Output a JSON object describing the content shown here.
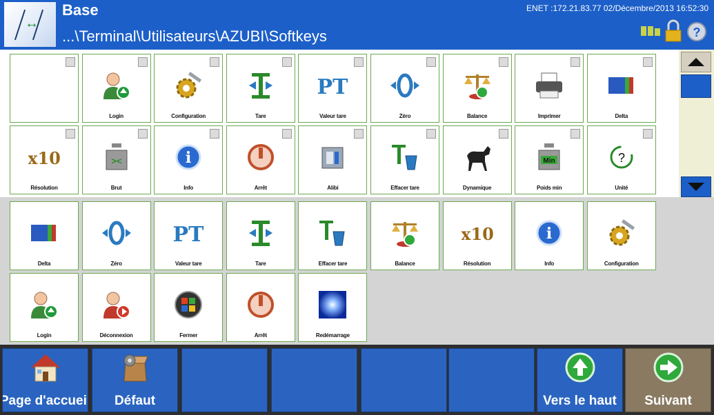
{
  "header": {
    "title": "Base",
    "path": "...\\Terminal\\Utilisateurs\\AZUBI\\Softkeys",
    "status": "ENET :172.21.83.77  02/Décembre/2013 16:52:30"
  },
  "top_tiles": [
    {
      "label": "",
      "icon": "blank"
    },
    {
      "label": "Login",
      "icon": "user-login-icon"
    },
    {
      "label": "Configuration",
      "icon": "configuration-icon"
    },
    {
      "label": "Tare",
      "icon": "tare-icon"
    },
    {
      "label": "Valeur tare",
      "icon": "preset-tare-icon"
    },
    {
      "label": "Zéro",
      "icon": "zero-icon"
    },
    {
      "label": "Balance",
      "icon": "balance-icon"
    },
    {
      "label": "Imprimer",
      "icon": "printer-icon"
    },
    {
      "label": "Delta",
      "icon": "delta-icon"
    },
    {
      "label": "Résolution",
      "icon": "x10-icon"
    },
    {
      "label": "Brut",
      "icon": "gross-weight-icon"
    },
    {
      "label": "Info",
      "icon": "info-icon"
    },
    {
      "label": "Arrêt",
      "icon": "power-icon"
    },
    {
      "label": "Alibi",
      "icon": "alibi-icon"
    },
    {
      "label": "Effacer tare",
      "icon": "clear-tare-icon"
    },
    {
      "label": "Dynamique",
      "icon": "horse-icon"
    },
    {
      "label": "Poids min",
      "icon": "min-weight-icon"
    },
    {
      "label": "Unité",
      "icon": "unit-icon"
    }
  ],
  "bottom_tiles": [
    {
      "label": "Delta",
      "icon": "delta-icon"
    },
    {
      "label": "Zéro",
      "icon": "zero-icon"
    },
    {
      "label": "Valeur tare",
      "icon": "preset-tare-icon"
    },
    {
      "label": "Tare",
      "icon": "tare-icon"
    },
    {
      "label": "Effacer tare",
      "icon": "clear-tare-icon"
    },
    {
      "label": "Balance",
      "icon": "balance-icon"
    },
    {
      "label": "Résolution",
      "icon": "x10-icon"
    },
    {
      "label": "Info",
      "icon": "info-icon"
    },
    {
      "label": "Configuration",
      "icon": "configuration-icon"
    },
    {
      "label": "Login",
      "icon": "user-login-icon"
    },
    {
      "label": "Déconnexion",
      "icon": "user-logout-icon"
    },
    {
      "label": "Fermer",
      "icon": "windows-icon"
    },
    {
      "label": "Arrêt",
      "icon": "power-icon"
    },
    {
      "label": "Redémarrage",
      "icon": "restart-icon"
    }
  ],
  "footer": {
    "home_label": "Page d'accueil",
    "default_label": "Défaut",
    "up_label": "Vers le haut",
    "next_label": "Suivant"
  },
  "colors": {
    "header_bg": "#1c5fc8",
    "tile_border": "#6aa84f",
    "footer_button": "#2a64c0",
    "next_button": "#8a7a62"
  }
}
